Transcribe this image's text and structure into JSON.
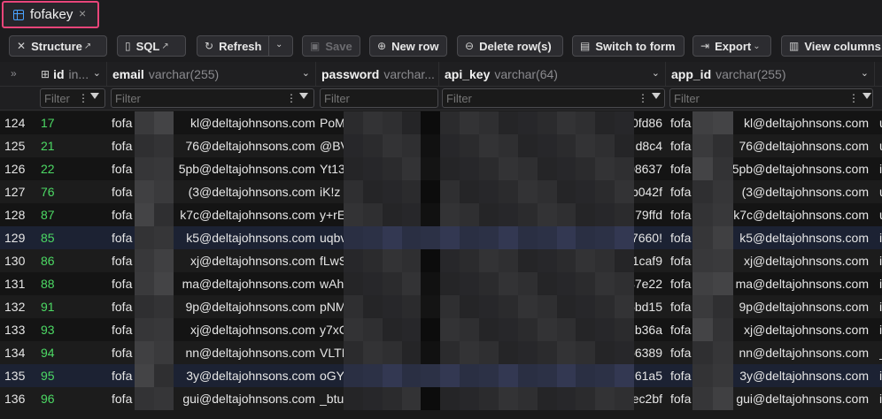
{
  "tab": {
    "title": "fofakey",
    "close": "×",
    "icon": "table-icon"
  },
  "toolbar": {
    "structure": "Structure",
    "sql": "SQL",
    "refresh": "Refresh",
    "save": "Save",
    "new_row": "New row",
    "delete_rows": "Delete row(s)",
    "switch_form": "Switch to form",
    "export": "Export",
    "view_columns": "View columns"
  },
  "grid": {
    "expand_glyph": "»",
    "columns": [
      {
        "name": "id",
        "type": "in..."
      },
      {
        "name": "email",
        "type": "varchar(255)"
      },
      {
        "name": "password",
        "type": "varchar..."
      },
      {
        "name": "api_key",
        "type": "varchar(64)"
      },
      {
        "name": "app_id",
        "type": "varchar(255)"
      }
    ],
    "filter_placeholder": "Filter",
    "rows": [
      {
        "num": "124",
        "id": "17",
        "email": "fofa",
        "email_tail": "kl@deltajohnsons.com",
        "pw": "PoM",
        "api": "0fd86",
        "app": "fofa",
        "app_tail": "kl@deltajohnsons.com",
        "more": "u"
      },
      {
        "num": "125",
        "id": "21",
        "email": "fofa",
        "email_tail": "76@deltajohnsons.com",
        "pw": "@BV",
        "api": "d8c4",
        "app": "fofa",
        "app_tail": "76@deltajohnsons.com",
        "more": "u"
      },
      {
        "num": "126",
        "id": "22",
        "email": "fofa",
        "email_tail": "5pb@deltajohnsons.com",
        "pw": "Yt13",
        "api": "08637",
        "app": "fofa",
        "app_tail": "5pb@deltajohnsons.com",
        "more": "i"
      },
      {
        "num": "127",
        "id": "76",
        "email": "fofa",
        "email_tail": "(3@deltajohnsons.com",
        "pw": "iK!z",
        "api": "b042f",
        "app": "fofa",
        "app_tail": "(3@deltajohnsons.com",
        "more": "u"
      },
      {
        "num": "128",
        "id": "87",
        "email": "fofa",
        "email_tail": "k7c@deltajohnsons.com",
        "pw": "y+rE",
        "api": "79ffd",
        "app": "fofa",
        "app_tail": "k7c@deltajohnsons.com",
        "more": "u"
      },
      {
        "num": "129",
        "id": "85",
        "email": "fofa",
        "email_tail": "k5@deltajohnsons.com",
        "pw": "uqbv",
        "api": "7660!",
        "app": "fofa",
        "app_tail": "k5@deltajohnsons.com",
        "more": "i"
      },
      {
        "num": "130",
        "id": "86",
        "email": "fofa",
        "email_tail": "xj@deltajohnsons.com",
        "pw": "fLwS",
        "api": "e1caf9",
        "app": "fofa",
        "app_tail": "xj@deltajohnsons.com",
        "more": "i"
      },
      {
        "num": "131",
        "id": "88",
        "email": "fofa",
        "email_tail": "ma@deltajohnsons.com",
        "pw": "wAh",
        "api": "37e22",
        "app": "fofa",
        "app_tail": "ma@deltajohnsons.com",
        "more": "i"
      },
      {
        "num": "132",
        "id": "91",
        "email": "fofa",
        "email_tail": "9p@deltajohnsons.com",
        "pw": "pNM",
        "api": "6bd15",
        "app": "fofa",
        "app_tail": "9p@deltajohnsons.com",
        "more": "i"
      },
      {
        "num": "133",
        "id": "93",
        "email": "fofa",
        "email_tail": "xj@deltajohnsons.com",
        "pw": "y7xC",
        "api": "b36a",
        "app": "fofa",
        "app_tail": "xj@deltajohnsons.com",
        "more": "i"
      },
      {
        "num": "134",
        "id": "94",
        "email": "fofa",
        "email_tail": "nn@deltajohnsons.com",
        "pw": "VLTI",
        "api": "66389",
        "app": "fofa",
        "app_tail": "nn@deltajohnsons.com",
        "more": "_"
      },
      {
        "num": "135",
        "id": "95",
        "email": "fofa",
        "email_tail": "3y@deltajohnsons.com",
        "pw": "oGY",
        "api": "61a5",
        "app": "fofa",
        "app_tail": "3y@deltajohnsons.com",
        "more": "i"
      },
      {
        "num": "136",
        "id": "96",
        "email": "fofa",
        "email_tail": "gui@deltajohnsons.com",
        "pw": "_btu",
        "api": "ec2bf",
        "app": "fofa",
        "app_tail": "gui@deltajohnsons.com",
        "more": "i"
      }
    ]
  },
  "colors": {
    "accent_tab_border": "#e8457a",
    "id_green": "#4cd964",
    "icon_blue": "#4aa3ff",
    "selected_row": "#1c2233"
  }
}
